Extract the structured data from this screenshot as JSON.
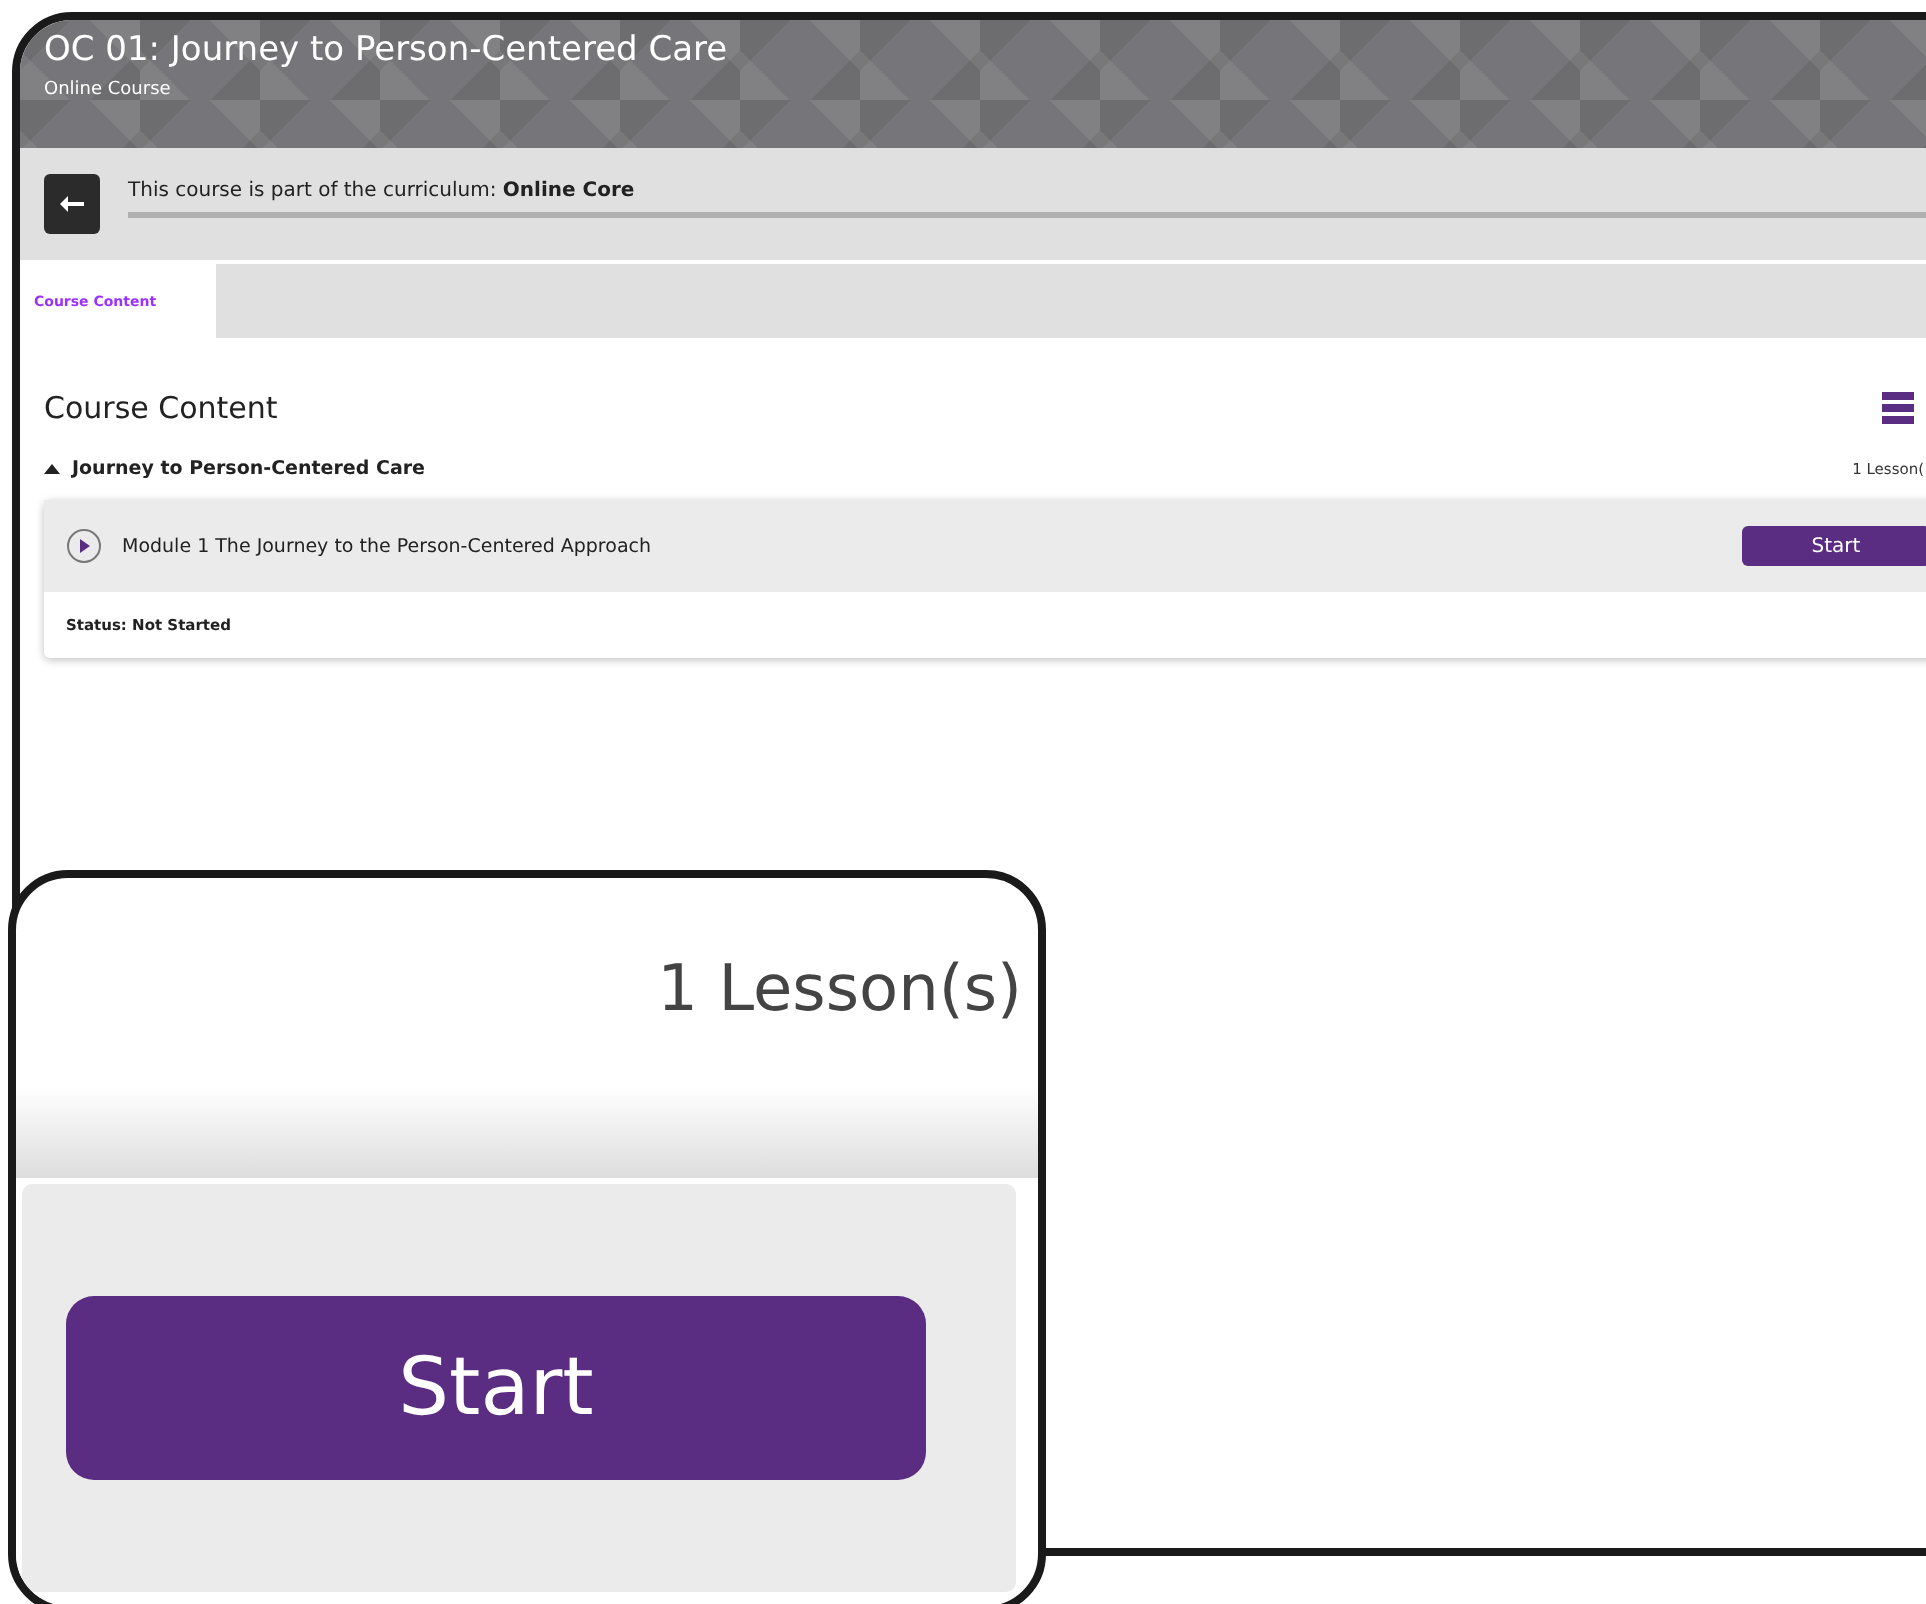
{
  "header": {
    "title": "OC 01: Journey to Person-Centered Care",
    "subtitle": "Online Course"
  },
  "curriculum_bar": {
    "text": "This course is part of the curriculum: **Online Core**"
  },
  "tabs": [
    {
      "label": "Course Content",
      "selected": true
    }
  ],
  "section_title": "Course Content",
  "module_group": {
    "title": "Journey to Person-Centered Care",
    "expanded": true,
    "lesson_count": "1 Lesson(",
    "lessons": [
      {
        "title": "Module 1 The Journey to the Person-Centered Approach",
        "button": "Start",
        "status": "Status: Not Started"
      }
    ]
  },
  "zoom_callout": {
    "lesson_count": "1 Lesson(s)",
    "button": "Start"
  }
}
